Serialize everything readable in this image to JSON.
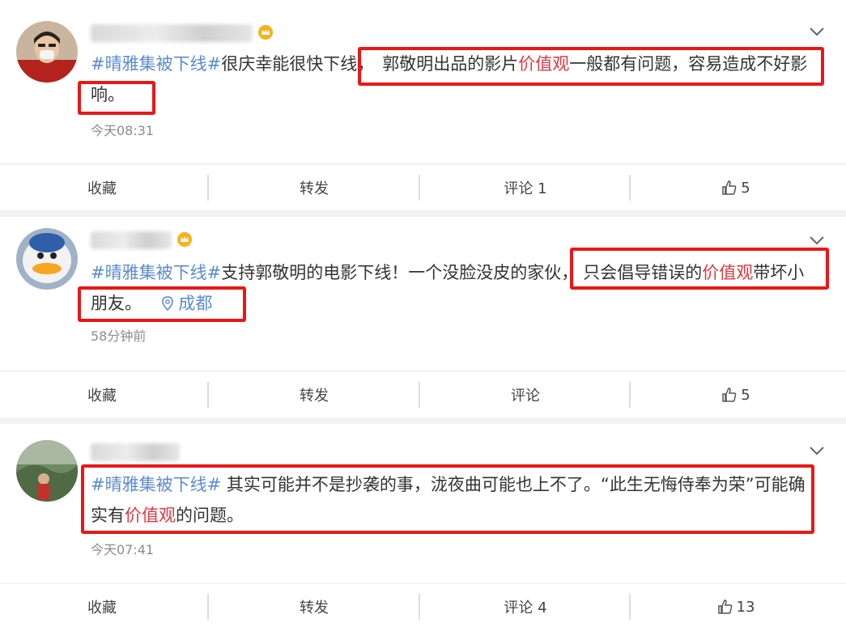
{
  "colors": {
    "hashtag": "#5b8bd0",
    "highlight": "#e0373f",
    "annotation_box": "#e81818"
  },
  "posts": [
    {
      "hashtag": "#晴雅集被下线#",
      "text_before": "很庆幸能很快下线，",
      "text_box_start": "郭敬明出品的影片",
      "keyword": "价值观",
      "text_after": "一般都有问题，容易造成不好影",
      "text_line2": "响。",
      "time": "今天08:31",
      "actions": {
        "favorite": "收藏",
        "repost": "转发",
        "comment": "评论 1",
        "like": "5"
      }
    },
    {
      "hashtag": "#晴雅集被下线#",
      "text_before": "支持郭敬明的电影下线！一个没脸没皮的家伙，",
      "text_box_start": "只会倡导错误的",
      "keyword": "价值观",
      "text_after": "带坏小",
      "text_line2": "朋友。",
      "location": "成都",
      "time": "58分钟前",
      "actions": {
        "favorite": "收藏",
        "repost": "转发",
        "comment": "评论",
        "like": "5"
      }
    },
    {
      "hashtag": "#晴雅集被下线#",
      "text_before": " 其实可能并不是抄袭的事，泷夜曲可能也上不了。“此生无悔侍奉为荣”可能确",
      "text_line2_before": "实有",
      "keyword": "价值观",
      "text_line2_after": "的问题。",
      "time": "今天07:41",
      "actions": {
        "favorite": "收藏",
        "repost": "转发",
        "comment": "评论 4",
        "like": "13"
      }
    }
  ]
}
